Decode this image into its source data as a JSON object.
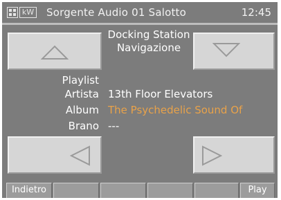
{
  "header": {
    "icon_grid": "grid-icon",
    "icon_kw": "kW",
    "title": "Sorgente Audio 01 Salotto",
    "time": "12:45"
  },
  "source": {
    "line1": "Docking Station",
    "line2": "Navigazione"
  },
  "info": {
    "playlist_label": "Playlist",
    "playlist_value": "",
    "artist_label": "Artista",
    "artist_value": "13th Floor Elevators",
    "album_label": "Album",
    "album_value": "The Psychedelic Sound Of",
    "track_label": "Brano",
    "track_value": "---"
  },
  "nav": {
    "up": "triangle-up-icon",
    "down": "triangle-down-icon",
    "left": "triangle-left-icon",
    "right": "triangle-right-icon"
  },
  "softkeys": {
    "back": "Indietro",
    "key2": "",
    "key3": "",
    "key4": "",
    "key5": "",
    "play": "Play"
  },
  "colors": {
    "panel_bg": "#7c7c7c",
    "button_face": "#d6d6d6",
    "accent": "#e8a24a",
    "text": "#ffffff"
  }
}
